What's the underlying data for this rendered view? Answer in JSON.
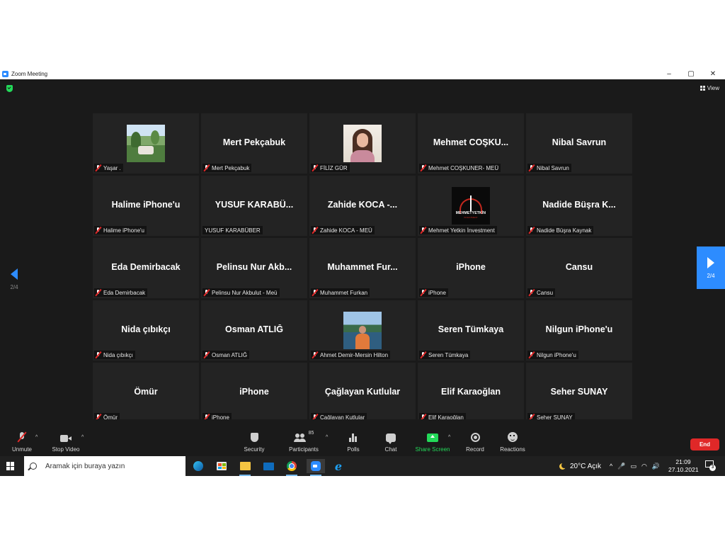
{
  "window": {
    "title": "Zoom Meeting",
    "controls": [
      "–",
      "▢",
      "✕"
    ]
  },
  "meeting": {
    "view_label": "View",
    "page_left": "2/4",
    "page_right": "2/4",
    "participants": [
      {
        "display": "",
        "name": "Yaşar .",
        "photo": "garden"
      },
      {
        "display": "Mert Pekçabuk",
        "name": "Mert Pekçabuk"
      },
      {
        "display": "",
        "name": "FİLİZ GÜR",
        "photo": "woman"
      },
      {
        "display": "Mehmet  COŞKU...",
        "name": "Mehmet COŞKUNER- MEÜ"
      },
      {
        "display": "Nibal Savrun",
        "name": "Nibal Savrun"
      },
      {
        "display": "Halime iPhone'u",
        "name": "Halime iPhone'u"
      },
      {
        "display": "YUSUF  KARABÜ...",
        "name": "YUSUF KARABÜBER",
        "unmuted": true
      },
      {
        "display": "Zahide  KOCA  -...",
        "name": "Zahide KOCA - MEÜ"
      },
      {
        "display": "",
        "name": "Mehmet Yetkin İnvestment",
        "photo": "logo",
        "logo_text": "MEHMETYETKİN",
        "logo_sub": "INVESTMENT"
      },
      {
        "display": "Nadide  Büşra  K...",
        "name": "Nadide Büşra Kaynak"
      },
      {
        "display": "Eda Demirbacak",
        "name": "Eda Demirbacak"
      },
      {
        "display": "Pelinsu  Nur  Akb...",
        "name": "Pelinsu Nur Akbulut - Meü"
      },
      {
        "display": "Muhammet  Fur...",
        "name": "Muhammet Furkan"
      },
      {
        "display": "iPhone",
        "name": "iPhone"
      },
      {
        "display": "Cansu",
        "name": "Cansu"
      },
      {
        "display": "Nida çıbıkçı",
        "name": "Nida çıbıkçı"
      },
      {
        "display": "Osman ATLIĞ",
        "name": "Osman ATLIĞ"
      },
      {
        "display": "",
        "name": "Ahmet Demir-Mersin Hilton",
        "photo": "lake"
      },
      {
        "display": "Seren Tümkaya",
        "name": "Seren Tümkaya"
      },
      {
        "display": "Nilgun iPhone'u",
        "name": "Nilgun iPhone'u"
      },
      {
        "display": "Ömür",
        "name": "Ömür"
      },
      {
        "display": "iPhone",
        "name": "iPhone"
      },
      {
        "display": "Çağlayan Kutlular",
        "name": "Çağlayan Kutlular"
      },
      {
        "display": "Elif Karaoğlan",
        "name": "Elif Karaoğlan"
      },
      {
        "display": "Seher SUNAY",
        "name": "Seher SUNAY"
      }
    ]
  },
  "toolbar": {
    "unmute": "Unmute",
    "stop_video": "Stop Video",
    "security": "Security",
    "participants": "Participants",
    "participants_count": "85",
    "polls": "Polls",
    "chat": "Chat",
    "share_screen": "Share Screen",
    "record": "Record",
    "reactions": "Reactions",
    "end": "End",
    "caret": "^",
    "share_color": "#23d959",
    "end_color": "#e02828"
  },
  "taskbar": {
    "search_placeholder": "Aramak için buraya yazın",
    "weather": "20°C  Açık",
    "time": "21:09",
    "date": "27.10.2021",
    "notifications": "3",
    "tray_icons": [
      "^",
      "🎤",
      "▭",
      "◠",
      "🔊"
    ]
  }
}
